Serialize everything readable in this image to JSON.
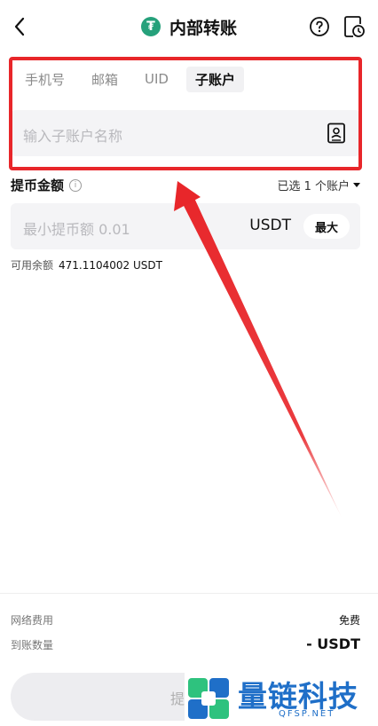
{
  "header": {
    "title": "内部转账",
    "coin_symbol": "₮",
    "icons": {
      "back": "back-chevron-icon",
      "help": "help-circle-icon",
      "history": "history-clock-icon"
    }
  },
  "tabs": [
    {
      "label": "手机号",
      "active": false
    },
    {
      "label": "邮箱",
      "active": false
    },
    {
      "label": "UID",
      "active": false
    },
    {
      "label": "子账户",
      "active": true
    }
  ],
  "sub_account": {
    "placeholder": "输入子账户名称",
    "icon": "contact-book-icon"
  },
  "amount": {
    "label": "提币金额",
    "info_icon": "info-icon",
    "selected_accounts": "已选 1 个账户",
    "placeholder": "最小提币额 0.01",
    "unit": "USDT",
    "max_label": "最大",
    "available_label": "可用余额",
    "available_value": "471.1104002 USDT"
  },
  "summary": {
    "fee_label": "网络费用",
    "fee_value": "免费",
    "receive_label": "到账数量",
    "receive_value": "- USDT"
  },
  "submit": {
    "label": "提"
  },
  "watermark": {
    "text": "量链科技",
    "url": "QFSP.NET"
  },
  "colors": {
    "accent_red": "#e8262a",
    "tether_green": "#26a17b",
    "watermark_blue": "#1f6fc8"
  }
}
